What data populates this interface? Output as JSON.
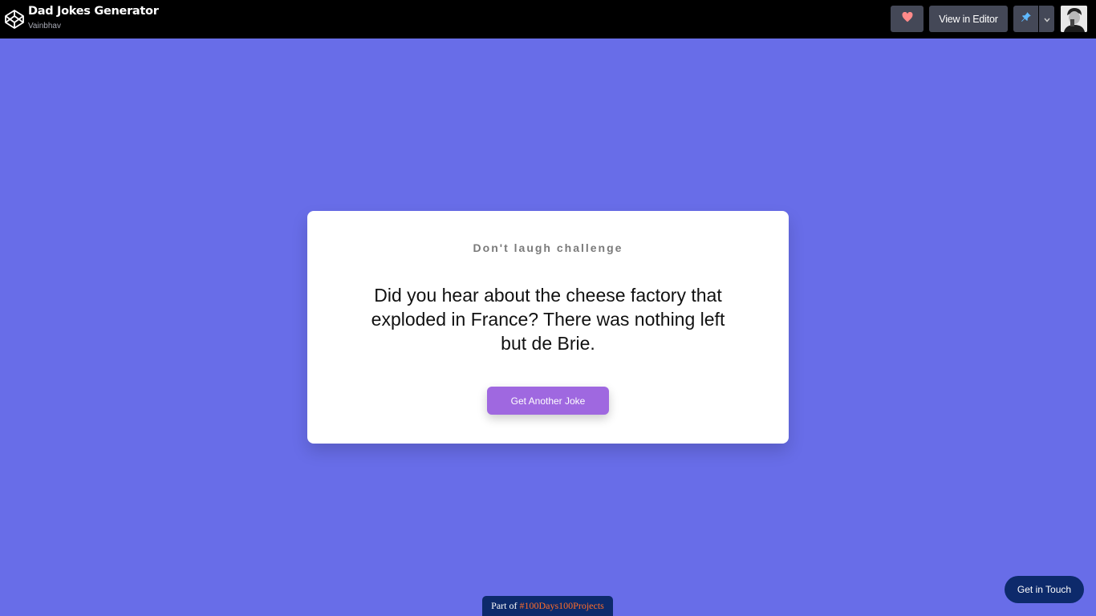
{
  "header": {
    "title": "Dad Jokes Generator",
    "author": "Vainbhav",
    "view_in_editor": "View in Editor",
    "icons": [
      "codepen-logo-icon",
      "heart-icon",
      "pin-icon",
      "chevron-down-icon",
      "user-avatar"
    ],
    "accent_heart": "#ff7a7a",
    "accent_pin": "#47cf73"
  },
  "card": {
    "heading": "Don't laugh challenge",
    "joke": "Did you hear about the cheese factory that exploded in France? There was nothing left but de Brie.",
    "button": "Get Another Joke"
  },
  "footer": {
    "part_of_prefix": "Part of ",
    "part_of_tag": "#100Days100Projects",
    "get_in_touch": "Get in Touch"
  },
  "colors": {
    "background": "#686de8",
    "button": "#9f68e0",
    "footer_badge": "#0d2a6b",
    "tag": "#ff6d2a"
  }
}
